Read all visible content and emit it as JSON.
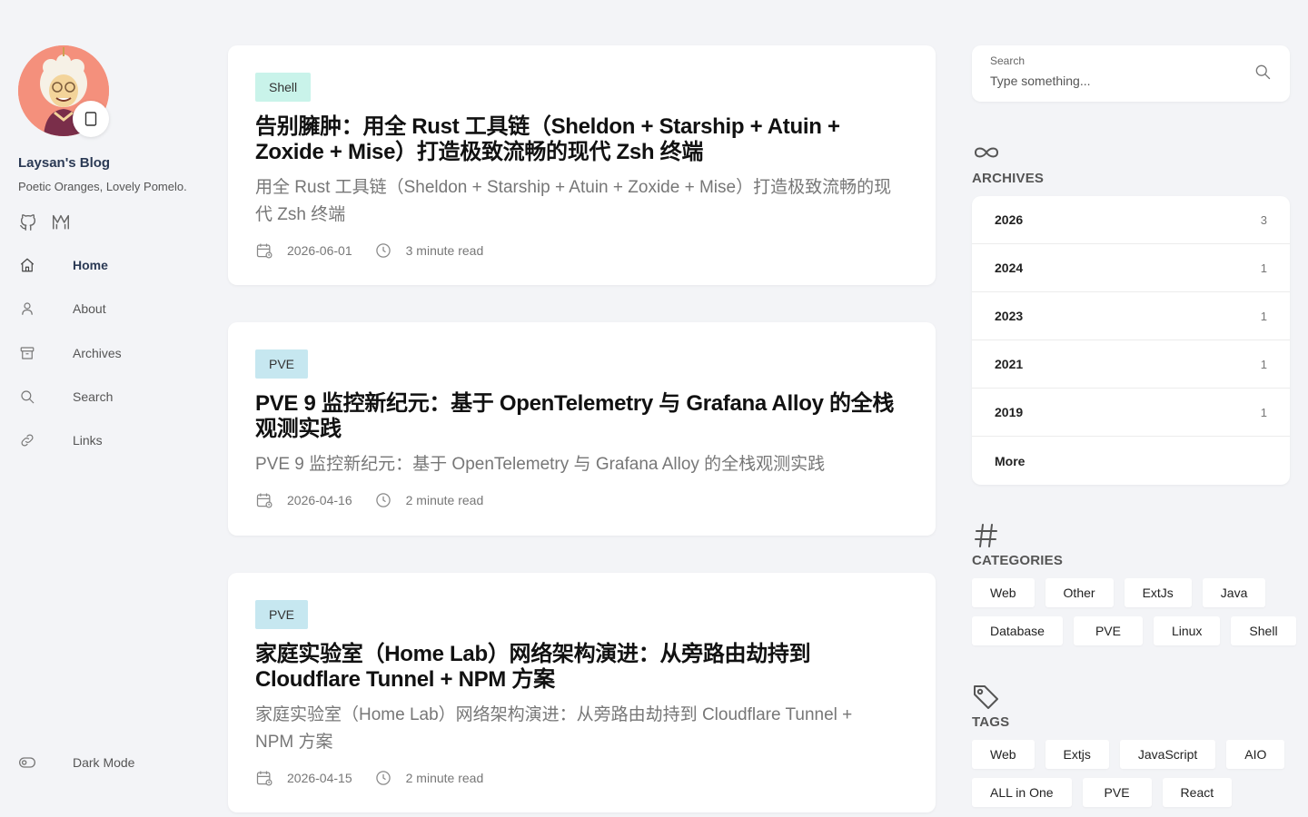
{
  "sidebar": {
    "blog_name": "Laysan's Blog",
    "tagline": "Poetic Oranges, Lovely Pomelo.",
    "social": [
      {
        "icon": "github-icon"
      },
      {
        "icon": "mastodon-icon"
      }
    ],
    "nav": [
      {
        "label": "Home",
        "icon": "home-icon",
        "active": true
      },
      {
        "label": "About",
        "icon": "user-icon",
        "active": false
      },
      {
        "label": "Archives",
        "icon": "archive-box-icon",
        "active": false
      },
      {
        "label": "Search",
        "icon": "search-icon",
        "active": false
      },
      {
        "label": "Links",
        "icon": "link-icon",
        "active": false
      }
    ],
    "dark_mode_label": "Dark Mode"
  },
  "posts": [
    {
      "tag": "Shell",
      "tag_color": "#c9f3ea",
      "title": "告别臃肿：用全 Rust 工具链（Sheldon + Starship + Atuin + Zoxide + Mise）打造极致流畅的现代 Zsh 终端",
      "excerpt": "用全 Rust 工具链（Sheldon + Starship + Atuin + Zoxide + Mise）打造极致流畅的现代 Zsh 终端",
      "date": "2026-06-01",
      "read_time": "3 minute read"
    },
    {
      "tag": "PVE",
      "tag_color": "#c6e7f0",
      "title": "PVE 9 监控新纪元：基于 OpenTelemetry 与 Grafana Alloy 的全栈观测实践",
      "excerpt": "PVE 9 监控新纪元：基于 OpenTelemetry 与 Grafana Alloy 的全栈观测实践",
      "date": "2026-04-16",
      "read_time": "2 minute read"
    },
    {
      "tag": "PVE",
      "tag_color": "#c6e7f0",
      "title": "家庭实验室（Home Lab）网络架构演进：从旁路由劫持到 Cloudflare Tunnel + NPM 方案",
      "excerpt": "家庭实验室（Home Lab）网络架构演进：从旁路由劫持到 Cloudflare Tunnel + NPM 方案",
      "date": "2026-04-15",
      "read_time": "2 minute read"
    }
  ],
  "search": {
    "label": "Search",
    "placeholder": "Type something..."
  },
  "archives": {
    "title": "ARCHIVES",
    "items": [
      {
        "year": "2026",
        "count": "3"
      },
      {
        "year": "2024",
        "count": "1"
      },
      {
        "year": "2023",
        "count": "1"
      },
      {
        "year": "2021",
        "count": "1"
      },
      {
        "year": "2019",
        "count": "1"
      }
    ],
    "more_label": "More"
  },
  "categories": {
    "title": "CATEGORIES",
    "items": [
      "Web",
      "Other",
      "ExtJs",
      "Java",
      "Database",
      "PVE",
      "Linux",
      "Shell"
    ]
  },
  "tags": {
    "title": "TAGS",
    "items": [
      "Web",
      "Extjs",
      "JavaScript",
      "AIO",
      "ALL in One",
      "PVE",
      "React"
    ]
  }
}
